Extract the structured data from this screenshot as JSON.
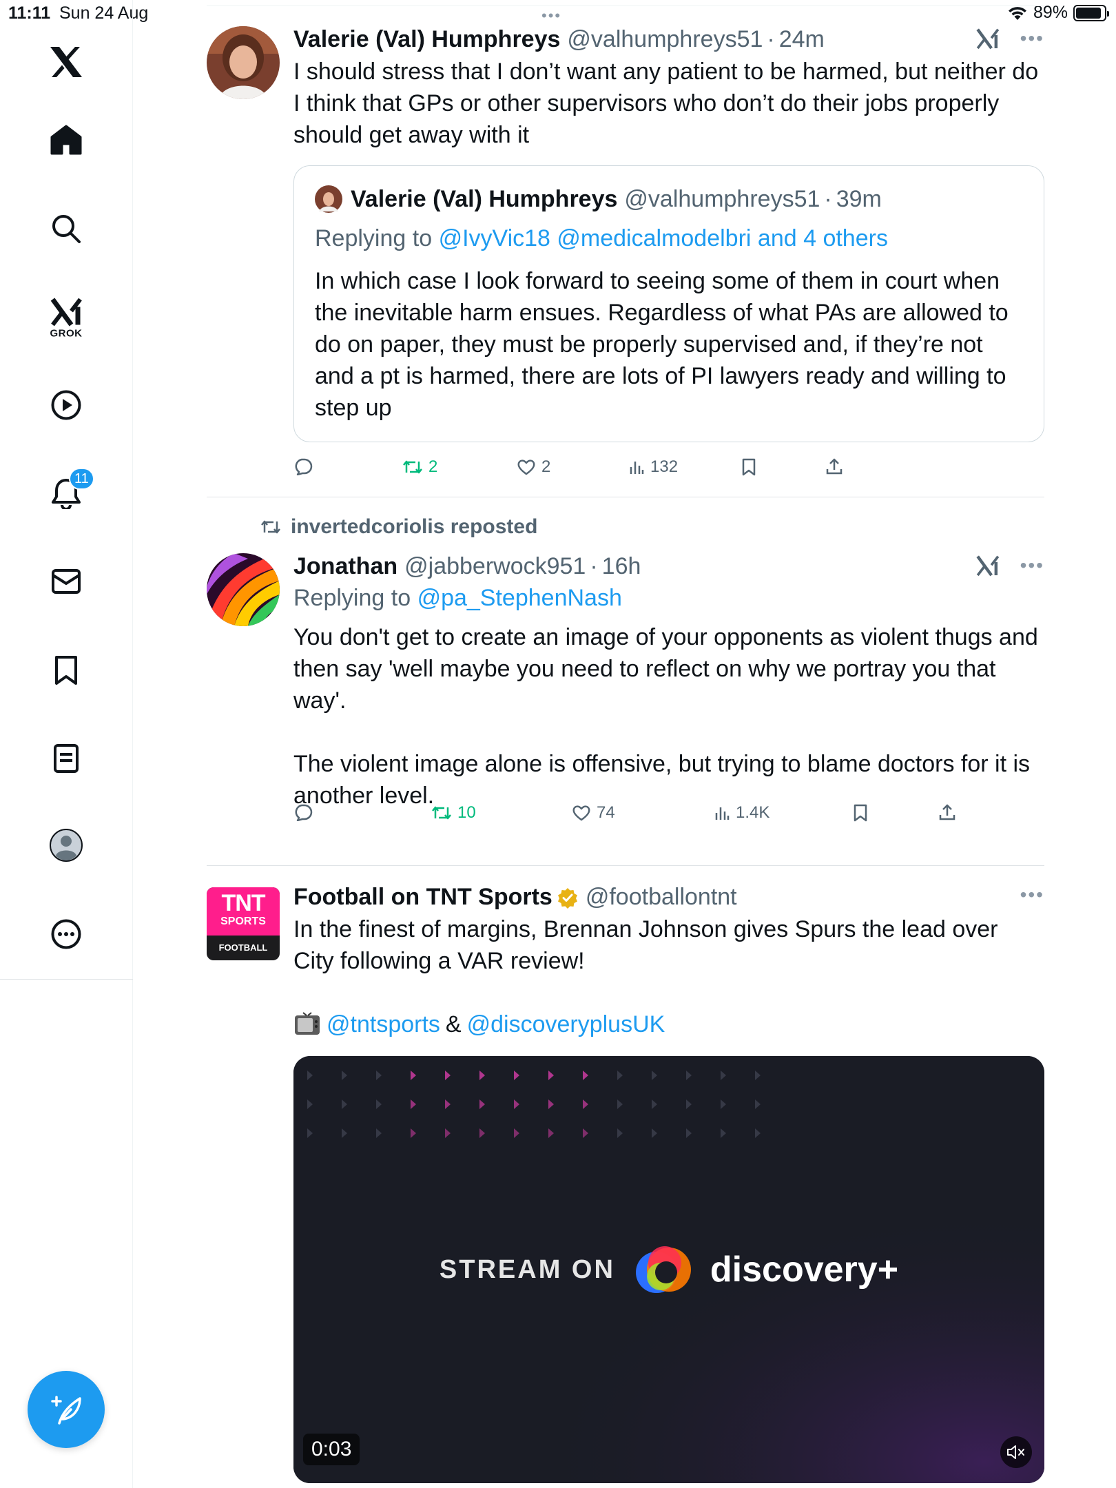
{
  "status_bar": {
    "time": "11:11",
    "date": "Sun 24 Aug",
    "battery": "89%",
    "battery_level": 0.89
  },
  "sidebar": {
    "grok_label": "GROK",
    "notification_count": "11"
  },
  "posts": [
    {
      "name": "Valerie (Val) Humphreys",
      "handle": "@valhumphreys51",
      "time": "24m",
      "text": "I should stress that I don’t want any patient to be harmed, but neither do I think that GPs or other supervisors who don’t do their jobs properly should get away with it",
      "quote": {
        "name": "Valerie (Val) Humphreys",
        "handle": "@valhumphreys51",
        "time": "39m",
        "replying_prefix": "Replying to",
        "replying_to": "@IvyVic18 @medicalmodelbri and 4 others",
        "text": "In which case I look forward to seeing some of them in court when the inevitable harm ensues. Regardless of what PAs are allowed to do on paper, they must be properly supervised and, if they’re not and a pt is harmed, there are lots of PI lawyers ready and willing to step up"
      },
      "reposts": "2",
      "likes": "2",
      "views": "132"
    },
    {
      "reposted_by": "invertedcoriolis reposted",
      "name": "Jonathan",
      "handle": "@jabberwock951",
      "time": "16h",
      "replying_prefix": "Replying to",
      "replying_to": "@pa_StephenNash",
      "text": "You don't get to create an image of your opponents as violent thugs and then say 'well maybe you need to reflect on why we portray you that way'.\n\nThe violent image alone is offensive, but trying to blame doctors for it is another level.",
      "reposts": "10",
      "likes": "74",
      "views": "1.4K"
    },
    {
      "name": "Football on TNT Sports",
      "handle": "@footballontnt",
      "text": "In the finest of margins, Brennan Johnson gives Spurs the lead over City following a VAR review!",
      "mentions": {
        "first": "@tntsports",
        "amp": "&",
        "second": "@discoveryplusUK"
      },
      "avatar": {
        "line1": "TNT",
        "line2": "SPORTS",
        "line3": "FOOTBALL"
      },
      "video": {
        "stream_on": "STREAM ON",
        "brand": "discovery+",
        "timestamp": "0:03"
      }
    }
  ],
  "colors": {
    "accent": "#1d9bf0",
    "repost_green": "#00ba7c",
    "muted": "#536471",
    "tnt_pink": "#ff1e8c"
  }
}
